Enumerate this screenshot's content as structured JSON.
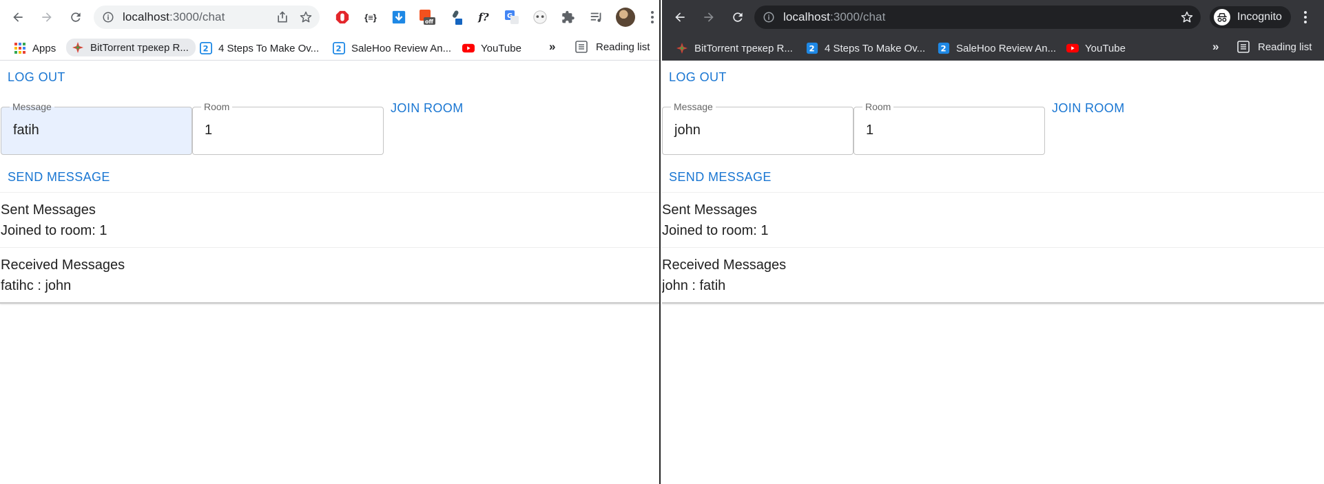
{
  "left": {
    "url_host": "localhost",
    "url_path": ":3000/chat",
    "bookmarks": {
      "apps": "Apps",
      "bittorrent": "BitTorrent трекер R...",
      "steps": "4 Steps To Make Ov...",
      "salehoo": "SaleHoo Review An...",
      "youtube": "YouTube",
      "chevrons": "»",
      "reading_list": "Reading list"
    },
    "extensions": [
      "{≡}",
      "f?"
    ],
    "logout": "LOG OUT",
    "message_label": "Message",
    "message_value": "fatih",
    "room_label": "Room",
    "room_value": "1",
    "join": "JOIN ROOM",
    "send": "SEND MESSAGE",
    "sent_heading": "Sent Messages",
    "sent_line": "Joined to room: 1",
    "received_heading": "Received Messages",
    "received_line": "fatihc : john"
  },
  "right": {
    "url_host": "localhost",
    "url_path": ":3000/chat",
    "incognito": "Incognito",
    "bookmarks": {
      "bittorrent": "BitTorrent трекер R...",
      "steps": "4 Steps To Make Ov...",
      "salehoo": "SaleHoo Review An...",
      "youtube": "YouTube",
      "chevrons": "»",
      "reading_list": "Reading list"
    },
    "logout": "LOG OUT",
    "message_label": "Message",
    "message_value": "john",
    "room_label": "Room",
    "room_value": "1",
    "join": "JOIN ROOM",
    "send": "SEND MESSAGE",
    "sent_heading": "Sent Messages",
    "sent_line": "Joined to room: 1",
    "received_heading": "Received Messages",
    "received_line": "john : fatih"
  },
  "colors": {
    "accent": "#1976d2",
    "dark_toolbar": "#35363a",
    "autofill": "#e8f0fe"
  },
  "icons": [
    "back-icon",
    "forward-icon",
    "reload-icon",
    "info-icon",
    "share-icon",
    "star-icon",
    "puzzle-icon",
    "media-icon",
    "incognito-icon",
    "apps-grid-icon",
    "bittorrent-icon",
    "youtube-icon",
    "reading-list-icon"
  ]
}
